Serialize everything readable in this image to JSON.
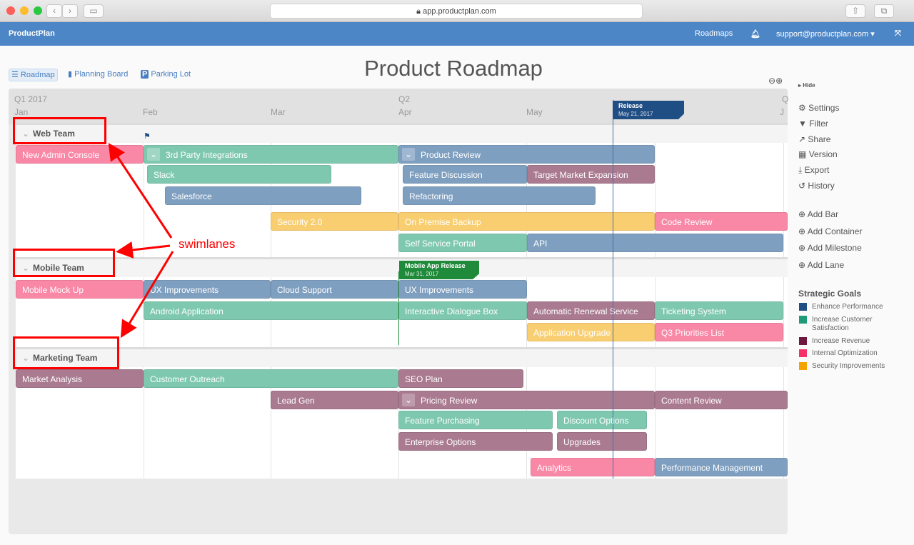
{
  "browser": {
    "url": "app.productplan.com"
  },
  "topbar": {
    "brand": "ProductPlan",
    "roadmaps": "Roadmaps",
    "user": "support@productplan.com ▾"
  },
  "page_title": "Product Roadmap",
  "views": [
    "Roadmap",
    "Planning Board",
    "Parking Lot"
  ],
  "timeline": {
    "q1": "Q1 2017",
    "q2": "Q2",
    "q3": "Q",
    "months": [
      "Jan",
      "Feb",
      "Mar",
      "Apr",
      "May",
      "J"
    ]
  },
  "milestones": [
    {
      "title": "Release",
      "date": "May 21, 2017",
      "color": "#1f4e85"
    },
    {
      "title": "Mobile App Release",
      "date": "Mar 31, 2017",
      "color": "#1f8a3a"
    }
  ],
  "lanes": [
    "Web Team",
    "Mobile Team",
    "Marketing Team"
  ],
  "bars": [
    {
      "label": "New Admin Console",
      "goal": "pink"
    },
    {
      "label": "3rd Party Integrations",
      "goal": "green",
      "container": true
    },
    {
      "label": "Product Review",
      "goal": "blue",
      "container": true
    },
    {
      "label": "Slack",
      "goal": "green"
    },
    {
      "label": "Feature Discussion",
      "goal": "blue"
    },
    {
      "label": "Target Market Expansion",
      "goal": "maroon"
    },
    {
      "label": "Salesforce",
      "goal": "blue"
    },
    {
      "label": "Refactoring",
      "goal": "blue"
    },
    {
      "label": "Security 2.0",
      "goal": "yellow"
    },
    {
      "label": "On Premise Backup",
      "goal": "yellow"
    },
    {
      "label": "Code Review",
      "goal": "pink"
    },
    {
      "label": "Self Service Portal",
      "goal": "green"
    },
    {
      "label": "API",
      "goal": "blue"
    },
    {
      "label": "Mobile Mock Up",
      "goal": "pink"
    },
    {
      "label": "UX Improvements",
      "goal": "blue"
    },
    {
      "label": "Cloud Support",
      "goal": "blue"
    },
    {
      "label": "UX Improvements",
      "goal": "blue"
    },
    {
      "label": "Android Application",
      "goal": "green"
    },
    {
      "label": "Interactive Dialogue Box",
      "goal": "green"
    },
    {
      "label": "Automatic Renewal Service",
      "goal": "maroon"
    },
    {
      "label": "Ticketing System",
      "goal": "green"
    },
    {
      "label": "Application Upgrade",
      "goal": "yellow"
    },
    {
      "label": "Q3 Priorities List",
      "goal": "pink"
    },
    {
      "label": "Market Analysis",
      "goal": "maroon"
    },
    {
      "label": "Customer Outreach",
      "goal": "green"
    },
    {
      "label": "SEO Plan",
      "goal": "maroon"
    },
    {
      "label": "Lead Gen",
      "goal": "maroon"
    },
    {
      "label": "Pricing Review",
      "goal": "maroon",
      "container": true
    },
    {
      "label": "Content Review",
      "goal": "maroon"
    },
    {
      "label": "Feature Purchasing",
      "goal": "green"
    },
    {
      "label": "Discount Options",
      "goal": "green"
    },
    {
      "label": "Enterprise Options",
      "goal": "maroon"
    },
    {
      "label": "Upgrades",
      "goal": "maroon"
    },
    {
      "label": "Analytics",
      "goal": "pink"
    },
    {
      "label": "Performance Management",
      "goal": "blue"
    }
  ],
  "sidebar": {
    "hide": "Hide",
    "actions": [
      "Settings",
      "Filter",
      "Share",
      "Version",
      "Export",
      "History"
    ],
    "add": [
      "Add Bar",
      "Add Container",
      "Add Milestone",
      "Add Lane"
    ]
  },
  "legend": {
    "title": "Strategic Goals",
    "items": [
      {
        "label": "Enhance Performance",
        "color": "#1f4e85"
      },
      {
        "label": "Increase Customer Satisfaction",
        "color": "#1f9a78"
      },
      {
        "label": "Increase Revenue",
        "color": "#6e1840"
      },
      {
        "label": "Internal Optimization",
        "color": "#f5306a"
      },
      {
        "label": "Security Improvements",
        "color": "#f5a300"
      }
    ]
  },
  "annotation": "swimlanes"
}
